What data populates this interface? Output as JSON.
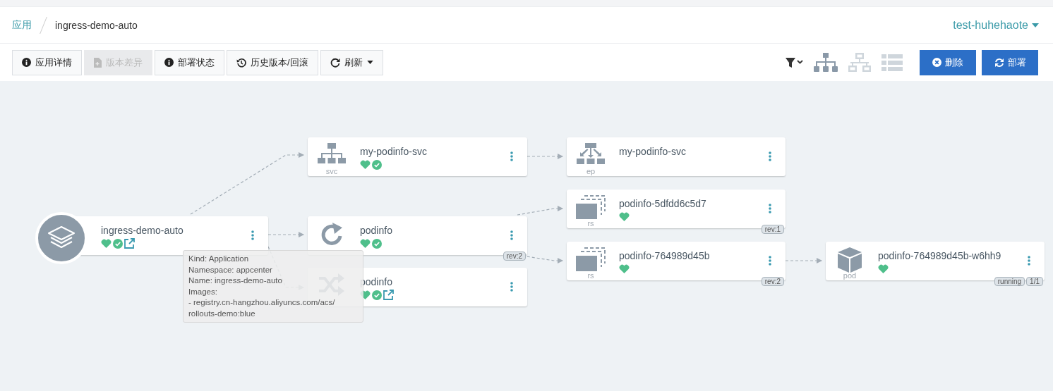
{
  "breadcrumb": {
    "root": "应用",
    "current": "ingress-demo-auto"
  },
  "cluster": {
    "label": "test-huhehaote"
  },
  "toolbar": {
    "buttons": [
      {
        "label": "应用详情",
        "disabled": false,
        "dropdown": false
      },
      {
        "label": "版本差异",
        "disabled": true,
        "dropdown": false
      },
      {
        "label": "部署状态",
        "disabled": false,
        "dropdown": false
      },
      {
        "label": "历史版本/回滚",
        "disabled": false,
        "dropdown": false
      },
      {
        "label": "刷新",
        "disabled": false,
        "dropdown": true
      }
    ],
    "view_modes": [
      {
        "kind": "tree",
        "selected": true
      },
      {
        "kind": "network",
        "selected": false
      },
      {
        "kind": "list",
        "selected": false
      }
    ],
    "actions": [
      {
        "label": "删除"
      },
      {
        "label": "部署"
      }
    ]
  },
  "nodes": [
    {
      "kind": "application",
      "name": "ingress-demo-auto",
      "healthy": true,
      "synced": true,
      "link": true
    },
    {
      "kind": "svc",
      "type_label": "svc",
      "name": "my-podinfo-svc",
      "healthy": true,
      "synced": true,
      "link": false
    },
    {
      "kind": "deploy",
      "name": "podinfo",
      "healthy": true,
      "synced": true,
      "link": false,
      "tags": [
        "rev:2"
      ]
    },
    {
      "kind": "ing",
      "name": "podinfo",
      "healthy": true,
      "synced": true,
      "link": true
    },
    {
      "kind": "ep",
      "type_label": "ep",
      "name": "my-podinfo-svc",
      "healthy": false,
      "synced": false,
      "link": false
    },
    {
      "kind": "rs",
      "type_label": "rs",
      "name": "podinfo-5dfdd6c5d7",
      "healthy": true,
      "synced": false,
      "link": false,
      "tags": [
        "rev:1"
      ]
    },
    {
      "kind": "rs",
      "type_label": "rs",
      "name": "podinfo-764989d45b",
      "healthy": true,
      "synced": false,
      "link": false,
      "tags": [
        "rev:2"
      ]
    },
    {
      "kind": "pod",
      "type_label": "pod",
      "name": "podinfo-764989d45b-w6hh9",
      "healthy": true,
      "synced": false,
      "link": false,
      "tags": [
        "running",
        "1/1"
      ]
    }
  ],
  "tooltip": {
    "lines": [
      "Kind: Application",
      "Namespace: appcenter",
      "Name: ingress-demo-auto",
      "Images:",
      "- registry.cn-hangzhou.aliyuncs.com/acs/",
      "rollouts-demo:blue"
    ]
  }
}
